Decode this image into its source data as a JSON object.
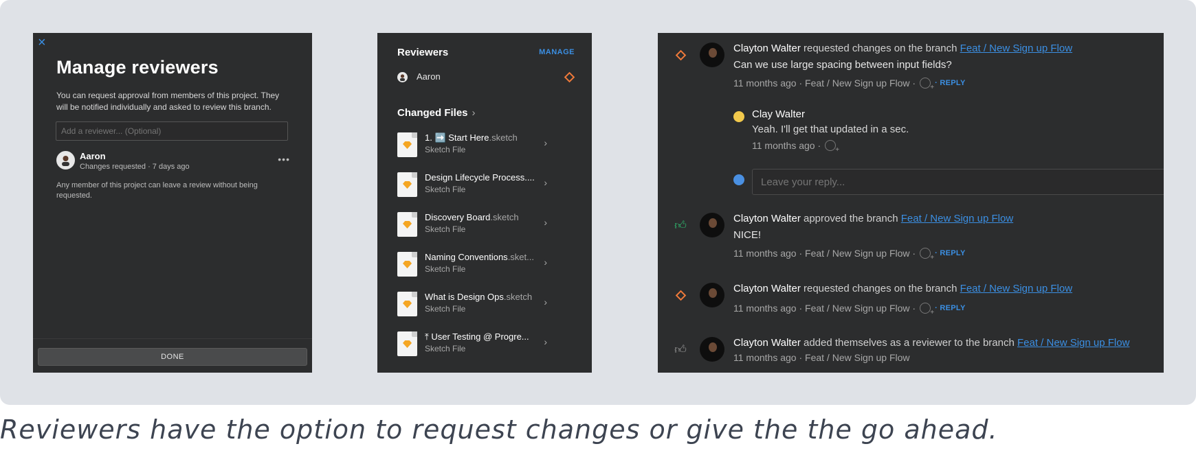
{
  "manage_panel": {
    "close_icon": "×",
    "title": "Manage reviewers",
    "description": "You can request approval from members of this project. They will be notified individually and asked to review this branch.",
    "input_placeholder": "Add a reviewer... (Optional)",
    "reviewer": {
      "name": "Aaron",
      "status": "Changes requested · 7 days ago",
      "more": "•••"
    },
    "note": "Any member of this project can leave a review without being requested.",
    "done_label": "DONE"
  },
  "sidebar_panel": {
    "reviewers_title": "Reviewers",
    "manage_label": "MANAGE",
    "reviewer_name": "Aaron",
    "changed_files_title": "Changed Files",
    "changed_files_chevron": "›",
    "files": [
      {
        "name": "1. ➡️ Start Here",
        "ext": ".sketch",
        "type": "Sketch File"
      },
      {
        "name": "Design Lifecycle Process....",
        "ext": "",
        "type": "Sketch File"
      },
      {
        "name": "Discovery Board",
        "ext": ".sketch",
        "type": "Sketch File"
      },
      {
        "name": "Naming Conventions",
        "ext": ".sket...",
        "type": "Sketch File"
      },
      {
        "name": "What is Design Ops",
        "ext": ".sketch",
        "type": "Sketch File"
      },
      {
        "name": "⤒ User Testing @ Progre...",
        "ext": "",
        "type": "Sketch File"
      }
    ]
  },
  "activity_panel": {
    "items": [
      {
        "status": "requested",
        "user": "Clayton Walter",
        "action": "requested changes on the branch",
        "branch": "Feat / New Sign up Flow",
        "body": "Can we use large spacing between input fields?",
        "time": "11 months ago · Feat / New Sign up Flow ·",
        "reply": "· REPLY"
      },
      {
        "status": "approved",
        "user": "Clayton Walter",
        "action": "approved the branch",
        "branch": "Feat / New Sign up Flow",
        "body": "NICE!",
        "time": "11 months ago · Feat / New Sign up Flow ·",
        "reply": "· REPLY"
      },
      {
        "status": "requested",
        "user": "Clayton Walter",
        "action": "requested changes on the branch",
        "branch": "Feat / New Sign up Flow",
        "body": "",
        "time": "11 months ago · Feat / New Sign up Flow ·",
        "reply": "· REPLY"
      },
      {
        "status": "added",
        "user": "Clayton Walter",
        "action": "added themselves as a reviewer to the branch",
        "branch": "Feat / New Sign up Flow",
        "body": "",
        "time": "11 months ago · Feat / New Sign up Flow",
        "reply": ""
      }
    ],
    "sub_reply": {
      "user": "Clay Walter",
      "text": "Yeah. I'll get that updated in a sec.",
      "time": "11 months ago ·"
    },
    "reply_placeholder": "Leave your reply..."
  },
  "caption": "Reviewers have the option to request changes or give the the go ahead.",
  "colors": {
    "accent": "#3b8fe3",
    "requested": "#f07a3a",
    "approved": "#2fbf71",
    "panel": "#2c2d2e"
  }
}
